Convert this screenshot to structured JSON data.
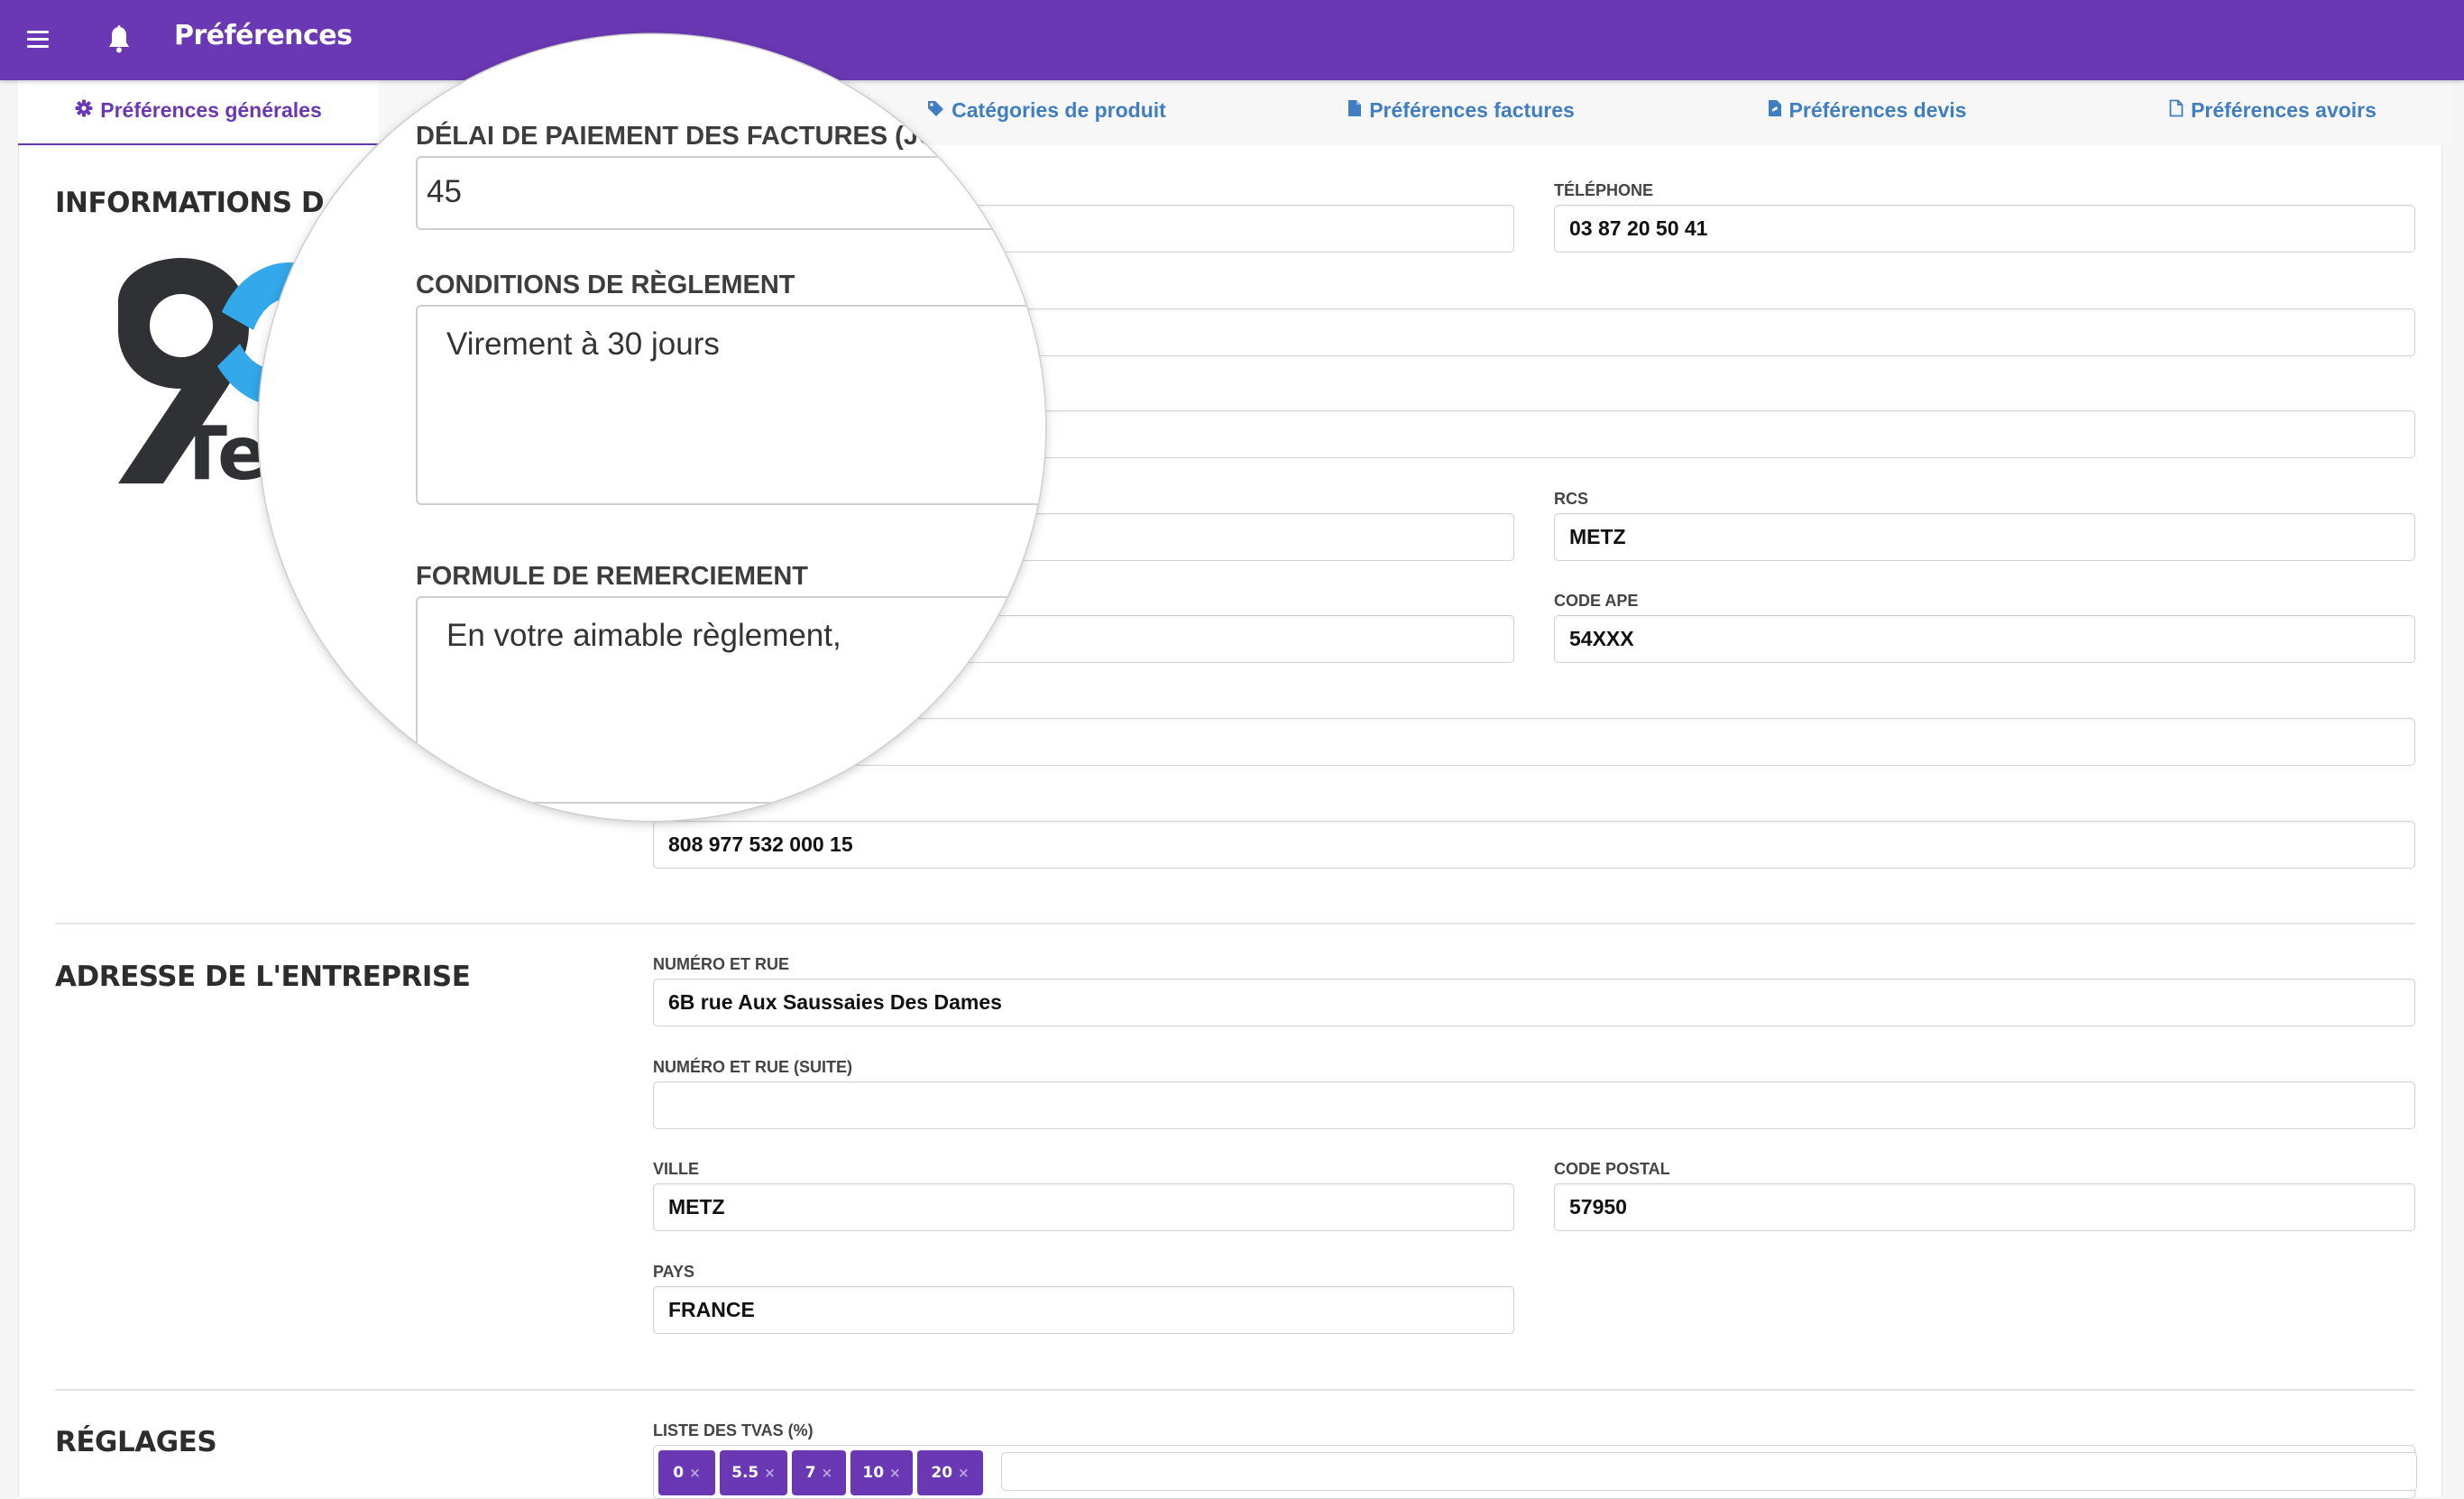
{
  "header": {
    "title": "Préférences",
    "menu_icon": "hamburger-icon",
    "notification_icon": "bell-icon",
    "background_color": "#6a38b4"
  },
  "tabs": [
    {
      "label": "Préférences générales",
      "icon": "gear-icon",
      "active": true
    },
    {
      "label": "Catégories de produit",
      "icon": "tag-icon",
      "active": false
    },
    {
      "label": "Préférences factures",
      "icon": "file-icon",
      "active": false
    },
    {
      "label": "Préférences devis",
      "icon": "file-edit-icon",
      "active": false
    },
    {
      "label": "Préférences avoirs",
      "icon": "file-outline-icon",
      "active": false
    }
  ],
  "company_info": {
    "title": "INFORMATIONS D",
    "logo_text": "Tec",
    "fields": {
      "hidden_left_1": {
        "label": "",
        "value": ""
      },
      "phone": {
        "label": "TÉLÉPHONE",
        "value": "03 87 20 50 41"
      },
      "wide_1": {
        "label": "",
        "value": ""
      },
      "wide_2": {
        "label": "",
        "value": ""
      },
      "hidden_left_2": {
        "label": "",
        "value": ""
      },
      "rcs": {
        "label": "RCS",
        "value": "METZ"
      },
      "hidden_left_3": {
        "label": "",
        "value": ""
      },
      "code_ape": {
        "label": "CODE APE",
        "value": "54XXX"
      },
      "wide_3": {
        "label": "",
        "value": ""
      },
      "siret": {
        "label": "",
        "value": "808 977 532 000 15"
      }
    }
  },
  "magnifier": {
    "payment_delay": {
      "label": "DÉLAI DE PAIEMENT DES FACTURES (JOUR",
      "value": "45"
    },
    "payment_terms": {
      "label": "CONDITIONS DE RÈGLEMENT",
      "value": "Virement à 30 jours"
    },
    "thanks_formula": {
      "label": "FORMULE DE REMERCIEMENT",
      "value": "En votre aimable règlement,"
    }
  },
  "address": {
    "title": "ADRESSE DE L'ENTREPRISE",
    "street": {
      "label": "NUMÉRO ET RUE",
      "value": "6B rue Aux Saussaies Des Dames"
    },
    "street2": {
      "label": "NUMÉRO ET RUE (SUITE)",
      "value": ""
    },
    "city": {
      "label": "VILLE",
      "value": "METZ"
    },
    "postal_code": {
      "label": "CODE POSTAL",
      "value": "57950"
    },
    "country": {
      "label": "PAYS",
      "value": "FRANCE"
    }
  },
  "settings": {
    "title": "RÉGLAGES",
    "vat_list_label": "LISTE DES TVAS (%)",
    "vat_rates": [
      "0",
      "5.5",
      "7",
      "10",
      "20"
    ],
    "remove_glyph": "×"
  }
}
